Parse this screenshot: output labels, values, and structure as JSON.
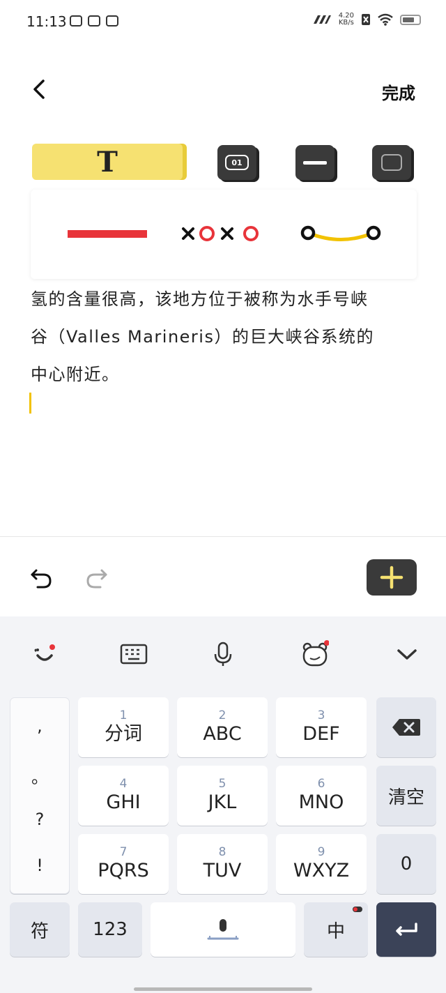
{
  "status": {
    "time": "11:13",
    "net_speed": "4.20",
    "net_unit": "KB/s"
  },
  "header": {
    "done_label": "完成"
  },
  "toolbar": {
    "text_tab_glyph": "T",
    "number_tab_label": "01"
  },
  "content": {
    "lines": [
      "氢的含量很高，该地方位于被称为水手号峡",
      "谷（Valles Marineris）的巨大峡谷系统的",
      "中心附近。"
    ]
  },
  "colors": {
    "accent_yellow": "#f6e171",
    "line_red": "#e8343a",
    "enter_key": "#3b4358"
  },
  "keyboard": {
    "punct": [
      ",",
      "。",
      "?",
      "!"
    ],
    "keys": [
      {
        "num": "1",
        "label": "分词"
      },
      {
        "num": "2",
        "label": "ABC"
      },
      {
        "num": "3",
        "label": "DEF"
      },
      {
        "num": "4",
        "label": "GHI"
      },
      {
        "num": "5",
        "label": "JKL"
      },
      {
        "num": "6",
        "label": "MNO"
      },
      {
        "num": "7",
        "label": "PQRS"
      },
      {
        "num": "8",
        "label": "TUV"
      },
      {
        "num": "9",
        "label": "WXYZ"
      }
    ],
    "clear_label": "清空",
    "zero_label": "0",
    "symbol_label": "符",
    "numeric_label": "123",
    "lang_label": "中"
  }
}
